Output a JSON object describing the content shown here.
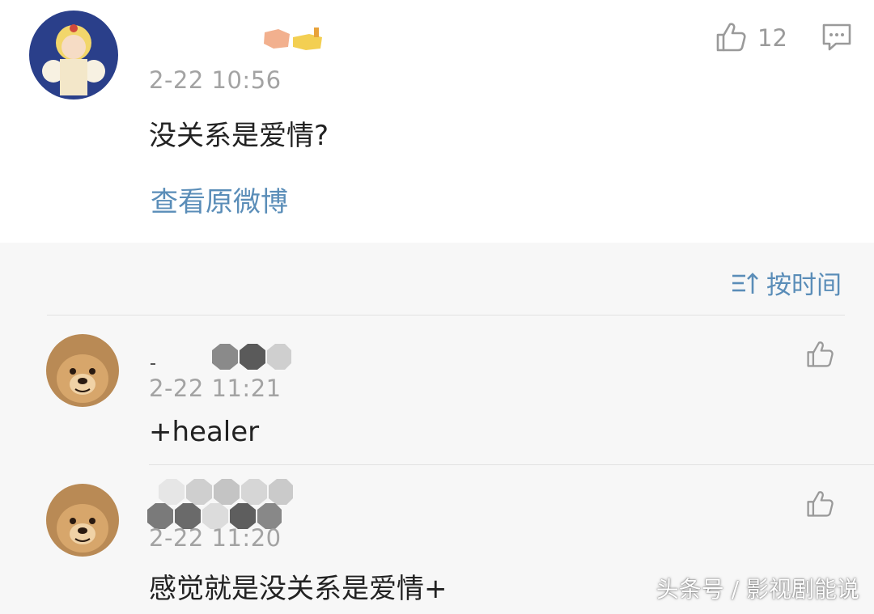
{
  "main_post": {
    "time": "2-22 10:56",
    "text": "没关系是爱情?",
    "like_count": "12",
    "view_original": "查看原微博"
  },
  "sort": {
    "label": "按时间"
  },
  "comments": [
    {
      "time": "2-22 11:21",
      "text": "+healer"
    },
    {
      "time": "2-22 11:20",
      "text": "感觉就是没关系是爱情+"
    }
  ],
  "watermark": "头条号 / 影视剧能说",
  "colors": {
    "link": "#5a8db8",
    "time": "#a3a3a3",
    "background": "#f7f7f7"
  },
  "icons": [
    "thumbs-up-icon",
    "comment-icon",
    "sort-icon"
  ]
}
